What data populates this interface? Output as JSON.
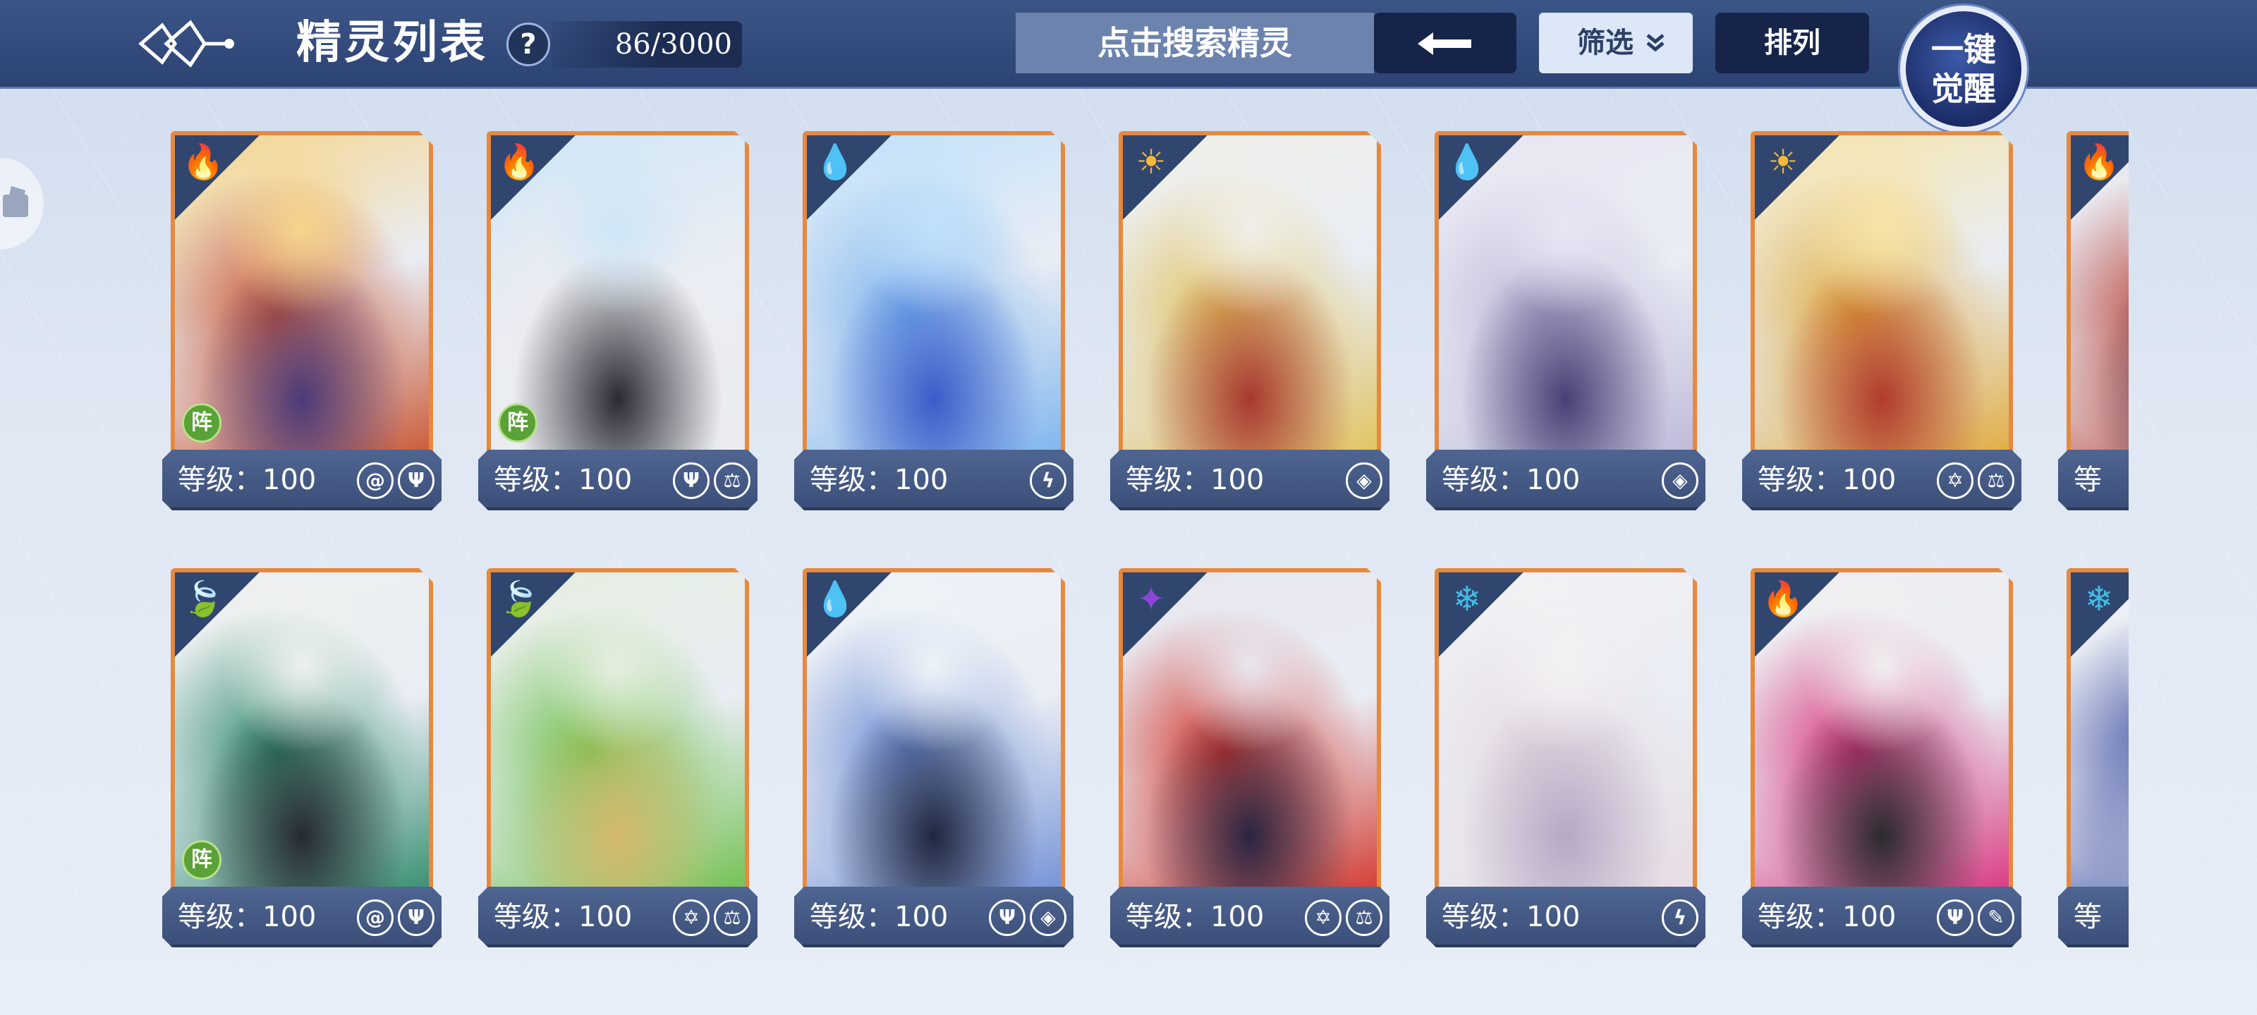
{
  "header": {
    "title": "精灵列表",
    "help_label": "?",
    "count": "86/3000",
    "search_placeholder": "点击搜索精灵",
    "filter_label": "筛选",
    "sort_label": "排列",
    "awaken_line1": "一键",
    "awaken_line2": "觉醒"
  },
  "level_label_prefix": "等级：",
  "cards": [
    {
      "element": "fire",
      "element_color": "#e2433d",
      "level": "100",
      "formation": "阵",
      "traits": [
        "swirl",
        "triple-blade"
      ],
      "palette": [
        "#f6d58b",
        "#c9532f",
        "#4b3a78"
      ]
    },
    {
      "element": "fire",
      "element_color": "#e2433d",
      "level": "100",
      "formation": "阵",
      "traits": [
        "trident",
        "scales"
      ],
      "palette": [
        "#cfe6f6",
        "#ececef",
        "#2a2a34"
      ]
    },
    {
      "element": "water",
      "element_color": "#3f7ee8",
      "level": "100",
      "formation": "",
      "traits": [
        "lightning"
      ],
      "palette": [
        "#bfe0fb",
        "#7ab3ee",
        "#3b5cc9"
      ]
    },
    {
      "element": "light",
      "element_color": "#f2b93a",
      "level": "100",
      "formation": "",
      "traits": [
        "shield"
      ],
      "palette": [
        "#f0efe8",
        "#e1c25a",
        "#a8392d"
      ]
    },
    {
      "element": "water",
      "element_color": "#3f7ee8",
      "level": "100",
      "formation": "",
      "traits": [
        "shield"
      ],
      "palette": [
        "#e7e6f3",
        "#bdb8d8",
        "#4a3f75"
      ]
    },
    {
      "element": "light",
      "element_color": "#f2b93a",
      "level": "100",
      "formation": "",
      "traits": [
        "star-cross",
        "scales"
      ],
      "palette": [
        "#f7e4a7",
        "#e0aa3a",
        "#b13b2d"
      ]
    },
    {
      "element": "fire",
      "element_color": "#e2433d",
      "level": "",
      "formation": "",
      "traits": [],
      "palette": [
        "#e9e7ee",
        "#b83a2e",
        "#5a4a5a"
      ],
      "partial": true
    },
    {
      "element": "grass",
      "element_color": "#6fbf3d",
      "level": "100",
      "formation": "阵",
      "traits": [
        "swirl",
        "triple-blade"
      ],
      "palette": [
        "#eef1ee",
        "#2f8a6c",
        "#262a32"
      ]
    },
    {
      "element": "grass",
      "element_color": "#6fbf3d",
      "level": "100",
      "formation": "",
      "traits": [
        "star-cross",
        "scales"
      ],
      "palette": [
        "#e5efe0",
        "#6cc04a",
        "#d4b86a"
      ]
    },
    {
      "element": "water",
      "element_color": "#3f7ee8",
      "level": "100",
      "formation": "",
      "traits": [
        "trident",
        "shield"
      ],
      "palette": [
        "#eef3f8",
        "#6f8ed6",
        "#1f2740"
      ]
    },
    {
      "element": "demon",
      "element_color": "#8b45d8",
      "level": "100",
      "formation": "",
      "traits": [
        "star-cross",
        "scales"
      ],
      "palette": [
        "#e8e6ee",
        "#d33329",
        "#2a2440"
      ]
    },
    {
      "element": "ice",
      "element_color": "#43bde4",
      "level": "100",
      "formation": "",
      "traits": [
        "lightning"
      ],
      "palette": [
        "#f3f1f3",
        "#e8dbe2",
        "#b7a8c4"
      ]
    },
    {
      "element": "fire",
      "element_color": "#e2433d",
      "level": "100",
      "formation": "",
      "traits": [
        "trident-ornate",
        "book"
      ],
      "palette": [
        "#f1eef0",
        "#d9317b",
        "#2a2a30"
      ]
    },
    {
      "element": "ice",
      "element_color": "#43bde4",
      "level": "",
      "formation": "",
      "traits": [],
      "palette": [
        "#eef1f5",
        "#3a4aa0",
        "#b7c2d8"
      ],
      "partial": true
    }
  ]
}
